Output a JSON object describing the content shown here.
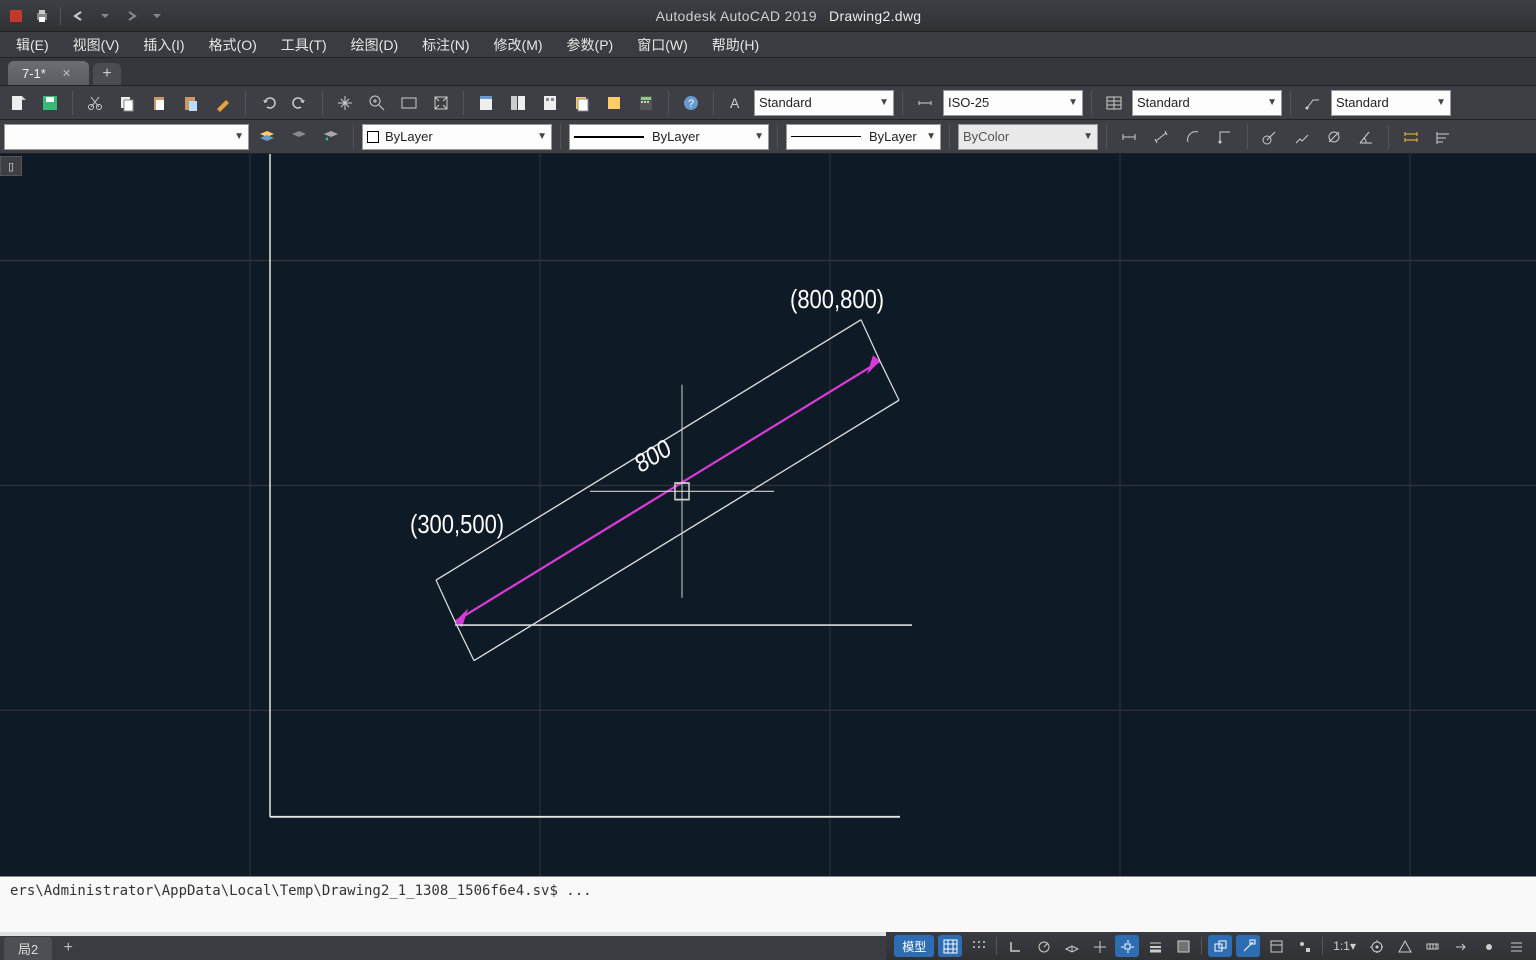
{
  "title": {
    "app": "Autodesk AutoCAD 2019",
    "file": "Drawing2.dwg"
  },
  "menu": {
    "items": [
      "辑(E)",
      "视图(V)",
      "插入(I)",
      "格式(O)",
      "工具(T)",
      "绘图(D)",
      "标注(N)",
      "修改(M)",
      "参数(P)",
      "窗口(W)",
      "帮助(H)"
    ]
  },
  "filetabs": {
    "tab1": "7-1*"
  },
  "toolbar1": {
    "textstyle": "Standard",
    "dimstyle": "ISO-25",
    "tablestyle": "Standard",
    "mleader": "Standard"
  },
  "toolbar2": {
    "colorLabel": "ByLayer",
    "linetypeLabel": "ByLayer",
    "lineweightLabel": "ByLayer",
    "plotstyleLabel": "ByColor"
  },
  "drawing": {
    "coord1": "(800,800)",
    "coord2": "(300,500)",
    "dimValue": "800"
  },
  "command": {
    "history": "ers\\Administrator\\AppData\\Local\\Temp\\Drawing2_1_1308_1506f6e4.sv$ ..."
  },
  "layoutTabs": {
    "tab1": "局2"
  },
  "status": {
    "model": "模型",
    "scale": "1:1"
  }
}
